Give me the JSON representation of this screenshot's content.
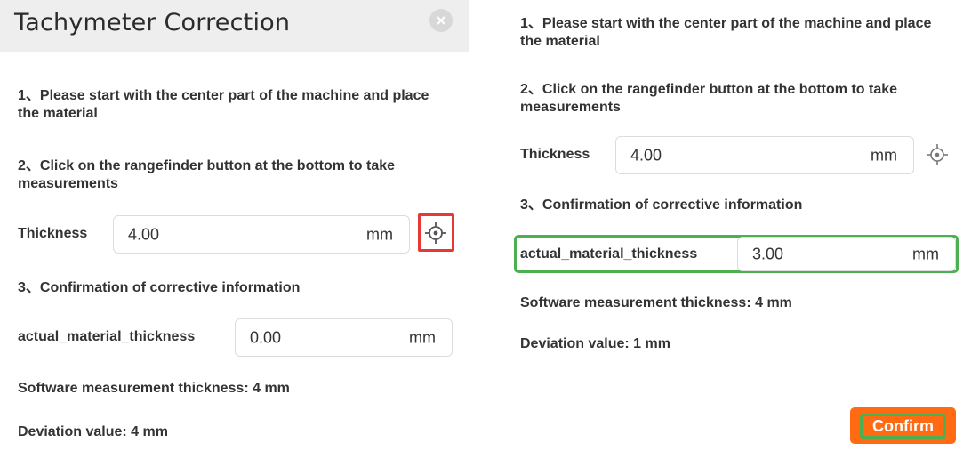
{
  "dialog": {
    "title": "Tachymeter Correction",
    "close_icon": "close-icon"
  },
  "left": {
    "step1": "1、Please start with the center part of the machine and place the material",
    "step2": "2、Click on the rangefinder button at the bottom to take measurements",
    "thickness_label": "Thickness",
    "thickness_value": "4.00",
    "thickness_unit": "mm",
    "rangefinder_icon": "crosshair-target-icon",
    "step3": "3、Confirmation of corrective information",
    "actual_label": "actual_material_thickness",
    "actual_value": "0.00",
    "actual_unit": "mm",
    "software_thickness": "Software measurement thickness: 4 mm",
    "deviation": "Deviation value: 4 mm"
  },
  "right": {
    "step1": "1、Please start with the center part of the machine and place the material",
    "step2": "2、Click on the rangefinder button at the bottom to take measurements",
    "thickness_label": "Thickness",
    "thickness_value": "4.00",
    "thickness_unit": "mm",
    "rangefinder_icon": "crosshair-target-icon",
    "step3": "3、Confirmation of corrective information",
    "actual_label": "actual_material_thickness",
    "actual_value": "3.00",
    "actual_unit": "mm",
    "software_thickness": "Software measurement thickness: 4 mm",
    "deviation": "Deviation value: 1 mm",
    "confirm_label": "Confirm"
  },
  "colors": {
    "accent_orange": "#ff6a13",
    "highlight_red": "#e53935",
    "highlight_green": "#4caf50"
  }
}
